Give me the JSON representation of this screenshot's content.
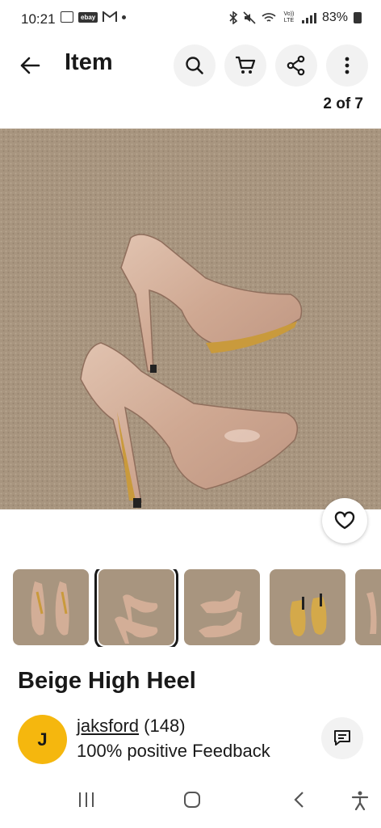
{
  "status_bar": {
    "time": "10:21",
    "ebay_badge": "ebay",
    "volte": "Vo)) LTE",
    "battery": "83%",
    "icons": [
      "gallery-icon",
      "ebay-icon",
      "gmail-icon",
      "dot-icon",
      "bluetooth-icon",
      "mute-icon",
      "wifi-icon",
      "signal-icon",
      "battery-icon"
    ]
  },
  "app_bar": {
    "title": "Item",
    "back_icon": "arrow-left-icon",
    "actions": [
      "search-icon",
      "cart-icon",
      "share-icon",
      "more-icon"
    ]
  },
  "gallery": {
    "counter": "2 of 7",
    "current_index": 2,
    "total": 7,
    "thumbnails": [
      "Photo 1",
      "Photo 2",
      "Photo 3",
      "Photo 4",
      "Photo 5"
    ],
    "selected_thumbnail": 2
  },
  "item": {
    "title": "Beige High Heel"
  },
  "seller": {
    "avatar_letter": "J",
    "name": "jaksford",
    "rating": "(148)",
    "feedback": "100% positive Feedback"
  },
  "nav_bar": {
    "items": [
      "recents-icon",
      "home-icon",
      "back-icon",
      "accessibility-icon"
    ]
  },
  "colors": {
    "accent": "#191919",
    "avatar": "#f5b70e",
    "carpet": "#a8957f",
    "shoe": "#d3ae97"
  }
}
